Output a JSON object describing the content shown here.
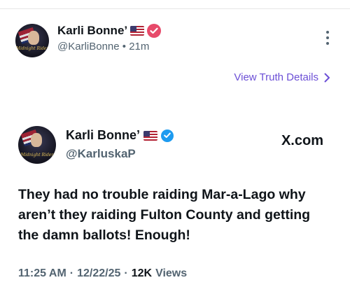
{
  "truth_post": {
    "author_name": "Karli Bonne’",
    "handle": "@KarliBonne",
    "time_ago": "21m",
    "separator": "•",
    "avatar_text": "Midnight Rider",
    "details_link": "View Truth Details"
  },
  "x_post": {
    "author_name": "Karli Bonne’",
    "handle": "@KarluskaP",
    "brand": "X.com",
    "avatar_text": "Midnight Rider",
    "text": "They had no trouble raiding Mar-a-Lago why aren’t they raiding Fulton County and getting the damn ballots! Enough!",
    "time": "11:25 AM",
    "date": "12/22/25",
    "views_count": "12K",
    "views_label": "Views",
    "dot": "·"
  },
  "colors": {
    "truth_verified": "#e74a6a",
    "x_verified": "#1d9bf0",
    "link": "#6c4fd6",
    "muted": "#536471"
  },
  "icons": {
    "flag": "us-flag-icon",
    "truth_badge": "truth-verified-icon",
    "x_badge": "x-verified-icon",
    "more": "more-vertical-icon",
    "chevron": "chevron-right-icon"
  }
}
